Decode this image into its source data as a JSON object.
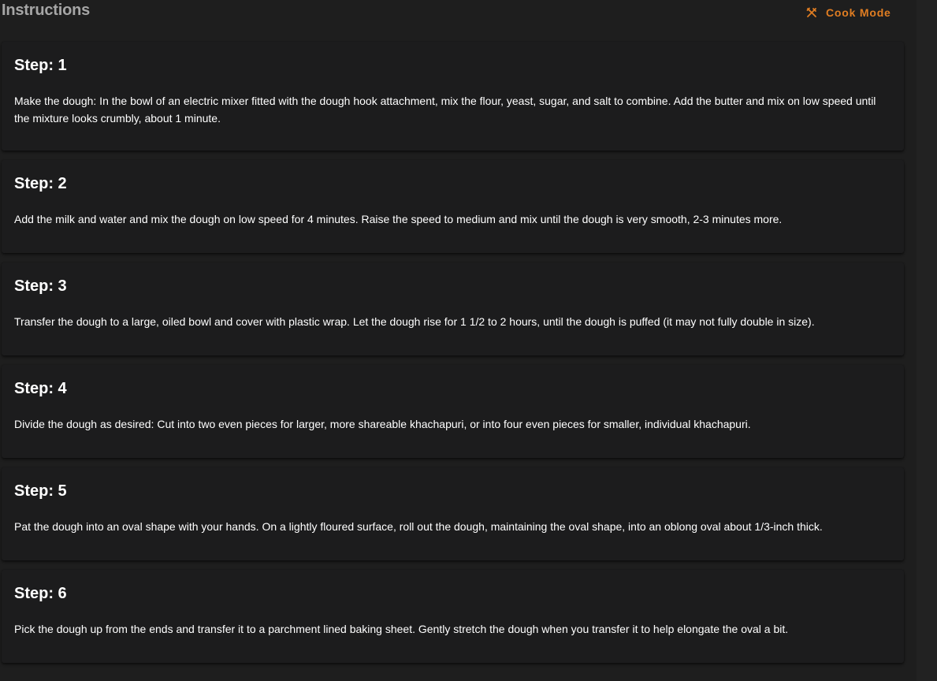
{
  "header": {
    "title": "Instructions",
    "cook_mode_label": "Cook Mode",
    "cook_mode_icon": "utensils-crossed-icon",
    "accent_color": "#e07d22"
  },
  "steps": [
    {
      "label": "Step: 1",
      "text": "Make the dough: In the bowl of an electric mixer fitted with the dough hook attachment, mix the flour, yeast, sugar, and salt to combine. Add the butter and mix on low speed until the mixture looks crumbly, about 1 minute."
    },
    {
      "label": "Step: 2",
      "text": "Add the milk and water and mix the dough on low speed for 4 minutes. Raise the speed to medium and mix until the dough is very smooth, 2-3 minutes more."
    },
    {
      "label": "Step: 3",
      "text": "Transfer the dough to a large, oiled bowl and cover with plastic wrap. Let the dough rise for 1 1/2 to 2 hours, until the dough is puffed (it may not fully double in size)."
    },
    {
      "label": "Step: 4",
      "text": "Divide the dough as desired: Cut into two even pieces for larger, more shareable khachapuri, or into four even pieces for smaller, individual khachapuri."
    },
    {
      "label": "Step: 5",
      "text": "Pat the dough into an oval shape with your hands. On a lightly floured surface, roll out the dough, maintaining the oval shape, into an oblong oval about 1/3-inch thick."
    },
    {
      "label": "Step: 6",
      "text": "Pick the dough up from the ends and transfer it to a parchment lined baking sheet. Gently stretch the dough when you transfer it to help elongate the oval a bit."
    }
  ]
}
